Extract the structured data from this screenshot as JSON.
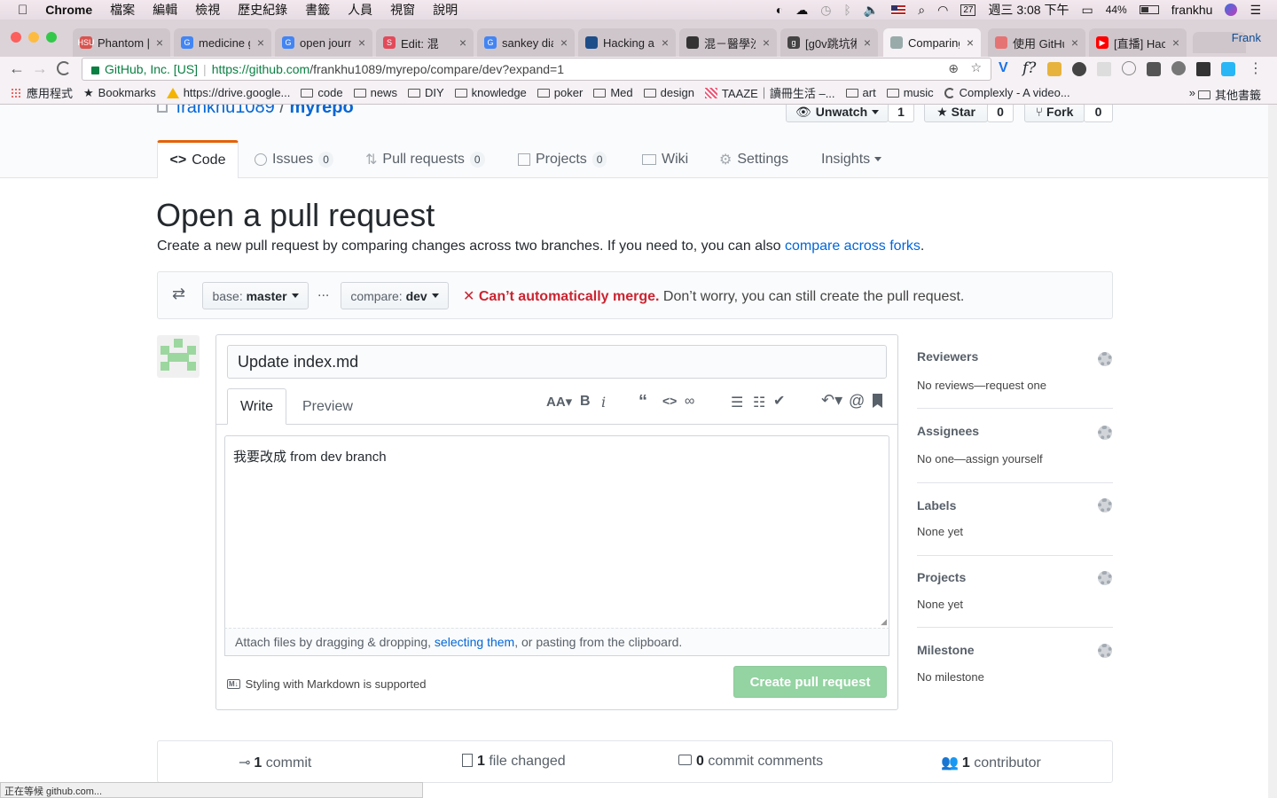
{
  "menubar": {
    "app": "Chrome",
    "items": [
      "檔案",
      "編輯",
      "檢視",
      "歷史紀錄",
      "書籤",
      "人員",
      "視窗",
      "說明"
    ],
    "date": "週三 3:08 下午",
    "battery": "44%",
    "user": "frankhu",
    "calendar_day": "27"
  },
  "tabs": [
    {
      "title": "Phantom |",
      "fav": "HSU",
      "color": "#d9534f"
    },
    {
      "title": "medicine g",
      "fav": "G",
      "color": "#4285f4"
    },
    {
      "title": "open journ",
      "fav": "G",
      "color": "#4285f4"
    },
    {
      "title": "Edit: 混",
      "fav": "S",
      "color": "#e24a5a"
    },
    {
      "title": "sankey dia",
      "fav": "G",
      "color": "#4285f4"
    },
    {
      "title": "Hacking a",
      "fav": "",
      "color": "#1d4e89"
    },
    {
      "title": "混－醫學沙",
      "fav": "",
      "color": "#333"
    },
    {
      "title": "[g0v跳坑術",
      "fav": "g",
      "color": "#444"
    },
    {
      "title": "Comparing",
      "fav": "",
      "color": "#9aa"
    },
    {
      "title": "使用 GitHu",
      "fav": "",
      "color": "#e57373"
    },
    {
      "title": "[直播] Hac",
      "fav": "▶",
      "color": "#ff0000"
    }
  ],
  "profile_tab": "Frank",
  "address": {
    "secure_label": "GitHub, Inc. [US]",
    "url_host": "https://github.com",
    "url_path": "/frankhu1089/myrepo/compare/dev?expand=1"
  },
  "bookmarks": [
    "應用程式",
    "Bookmarks",
    "https://drive.google...",
    "code",
    "news",
    "DIY",
    "knowledge",
    "poker",
    "Med",
    "design",
    "TAAZE｜讀冊生活 –...",
    "art",
    "music",
    "Complexly - A video...",
    "其他書籤"
  ],
  "repo": {
    "owner": "frankhu1089",
    "sep": "/",
    "name": "myrepo",
    "unwatch": "Unwatch",
    "watch_count": "1",
    "star": "Star",
    "star_count": "0",
    "fork": "Fork",
    "fork_count": "0"
  },
  "repo_tabs": [
    {
      "label": "Code",
      "count": ""
    },
    {
      "label": "Issues",
      "count": "0"
    },
    {
      "label": "Pull requests",
      "count": "0"
    },
    {
      "label": "Projects",
      "count": "0"
    },
    {
      "label": "Wiki",
      "count": ""
    },
    {
      "label": "Settings",
      "count": ""
    },
    {
      "label": "Insights",
      "count": ""
    }
  ],
  "heading": "Open a pull request",
  "subtitle": "Create a new pull request by comparing changes across two branches. If you need to, you can also ",
  "subtitle_link": "compare across forks",
  "subtitle_end": ".",
  "range": {
    "base_prefix": "base:",
    "base": "master",
    "dots": "...",
    "compare_prefix": "compare:",
    "compare": "dev",
    "merge_x": "✕",
    "merge_bad": "Can’t automatically merge.",
    "merge_note": " Don’t worry, you can still create the pull request."
  },
  "form": {
    "title_value": "Update index.md",
    "write_tab": "Write",
    "preview_tab": "Preview",
    "body": "我要改成 from dev branch",
    "attach_pre": "Attach files by dragging & dropping, ",
    "attach_link": "selecting them",
    "attach_post": ", or pasting from the clipboard.",
    "markdown_note": "Styling with Markdown is supported",
    "submit": "Create pull request"
  },
  "sidebar": [
    {
      "heading": "Reviewers",
      "value": "No reviews—request one"
    },
    {
      "heading": "Assignees",
      "value": "No one—assign yourself"
    },
    {
      "heading": "Labels",
      "value": "None yet"
    },
    {
      "heading": "Projects",
      "value": "None yet"
    },
    {
      "heading": "Milestone",
      "value": "No milestone"
    }
  ],
  "summary": [
    {
      "num": "1",
      "label": "commit"
    },
    {
      "num": "1",
      "label": "file changed"
    },
    {
      "num": "0",
      "label": "commit comments"
    },
    {
      "num": "1",
      "label": "contributor"
    }
  ],
  "statusbar": "正在等候 github.com...",
  "colors": {
    "accent": "#0366d6",
    "error": "#cb2431",
    "success_disabled": "#94d3a2",
    "tab_orange": "#e36209"
  }
}
